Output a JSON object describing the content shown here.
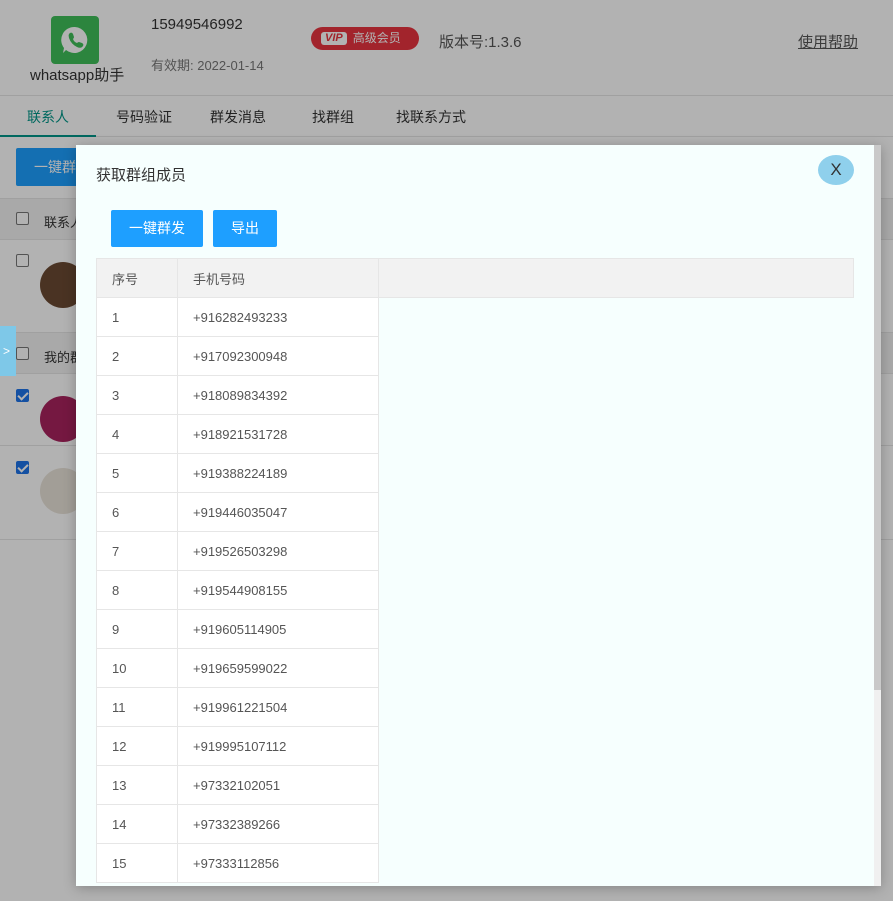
{
  "app": {
    "name": "whatsapp助手",
    "phone": "15949546992",
    "expiry": "有效期: 2022-01-14",
    "vip_tag": "VIP",
    "vip_label": "高级会员",
    "version": "版本号:1.3.6",
    "help": "使用帮助"
  },
  "tabs": [
    "联系人",
    "号码验证",
    "群发消息",
    "找群组",
    "找联系方式"
  ],
  "background": {
    "button": "一键群",
    "row_contacts": "联系人",
    "row_groups": "我的群",
    "side_toggle": ">"
  },
  "modal": {
    "title": "获取群组成员",
    "close": "X",
    "send_button": "一键群发",
    "export_button": "导出",
    "columns": [
      "序号",
      "手机号码"
    ],
    "rows": [
      {
        "no": "1",
        "phone": "+916282493233"
      },
      {
        "no": "2",
        "phone": "+917092300948"
      },
      {
        "no": "3",
        "phone": "+918089834392"
      },
      {
        "no": "4",
        "phone": "+918921531728"
      },
      {
        "no": "5",
        "phone": "+919388224189"
      },
      {
        "no": "6",
        "phone": "+919446035047"
      },
      {
        "no": "7",
        "phone": "+919526503298"
      },
      {
        "no": "8",
        "phone": "+919544908155"
      },
      {
        "no": "9",
        "phone": "+919605114905"
      },
      {
        "no": "10",
        "phone": "+919659599022"
      },
      {
        "no": "11",
        "phone": "+919961221504"
      },
      {
        "no": "12",
        "phone": "+919995107112"
      },
      {
        "no": "13",
        "phone": "+97332102051"
      },
      {
        "no": "14",
        "phone": "+97332389266"
      },
      {
        "no": "15",
        "phone": "+97333112856"
      }
    ]
  },
  "colors": {
    "primary": "#1e9fff",
    "tab_active": "#009688",
    "vip": "#e8343f",
    "close_button": "#8fd0ec"
  }
}
